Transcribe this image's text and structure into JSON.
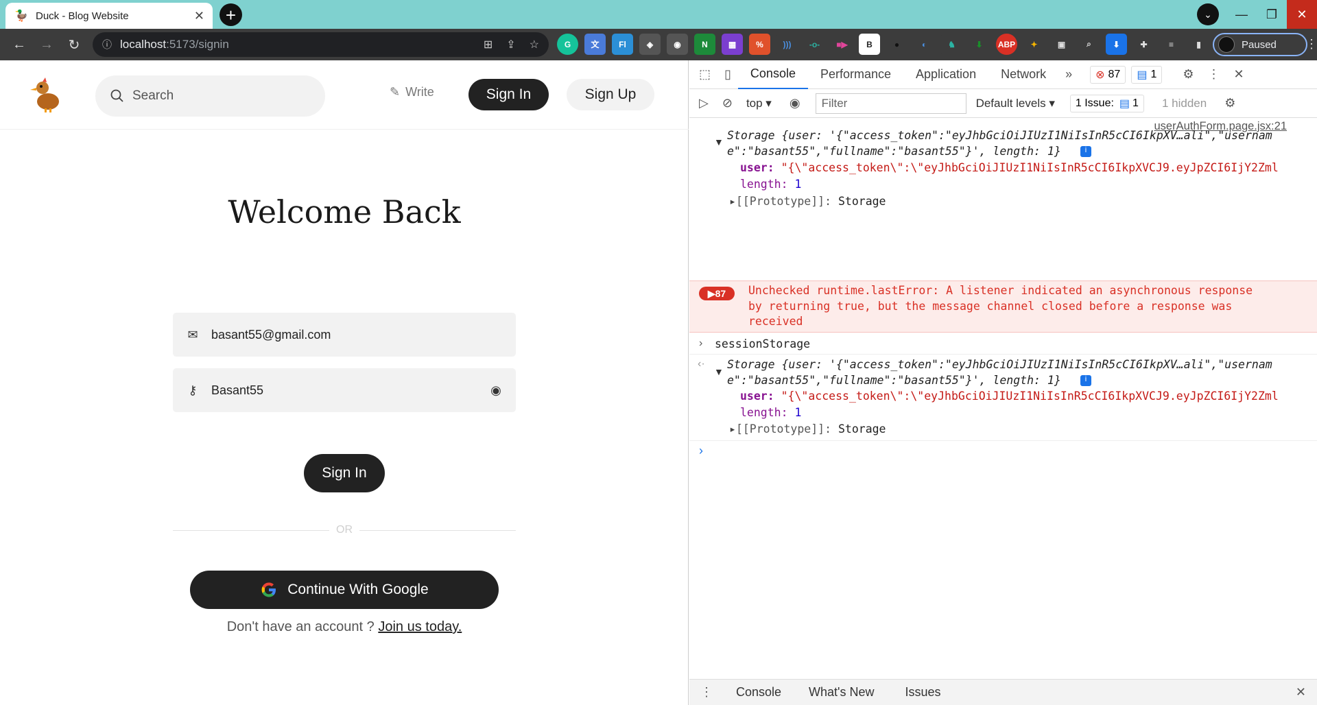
{
  "browser": {
    "tab_title": "Duck - Blog Website",
    "url_host": "localhost",
    "url_path": ":5173/signin",
    "profile_label": "Paused"
  },
  "site": {
    "search_placeholder": "Search",
    "write_label": "Write",
    "signin_top_label": "Sign In",
    "signup_label": "Sign Up",
    "heading": "Welcome Back",
    "email_value": "basant55@gmail.com",
    "password_value": "Basant55",
    "signin_button_label": "Sign In",
    "or_text": "OR",
    "google_label": "Continue With Google",
    "no_account_text": "Don't have an account ? ",
    "join_link": "Join us today."
  },
  "devtools": {
    "tabs": [
      "Console",
      "Performance",
      "Application",
      "Network"
    ],
    "more_tabs": "»",
    "error_count": "87",
    "message_count": "1",
    "context": "top",
    "filter_placeholder": "Filter",
    "levels": "Default levels",
    "issues_label": "1 Issue:",
    "issues_count": "1",
    "hidden": "1 hidden",
    "source_link": "userAuthForm.page.jsx:21",
    "log1_line1": "Storage {user: '{\"access_token\":\"eyJhbGciOiJIUzI1NiIsInR5cCI6IkpXV…ali\",\"usernam",
    "log1_line2": "e\":\"basant55\",\"fullname\":\"basant55\"}', length: 1}",
    "log1_user_key": "user:",
    "log1_user_val": "\"{\\\"access_token\\\":\\\"eyJhbGciOiJIUzI1NiIsInR5cCI6IkpXVCJ9.eyJpZCI6IjY2Zml",
    "length_key": "length:",
    "length_val": "1",
    "prototype_key": "[[Prototype]]:",
    "prototype_val": "Storage",
    "error_line1": "Unchecked runtime.lastError: A listener indicated an asynchronous response",
    "error_line2": "by returning true, but the message channel closed before a response was",
    "error_line3": "received",
    "input_cmd": "sessionStorage",
    "drawer_tabs": [
      "Console",
      "What's New",
      "Issues"
    ]
  }
}
